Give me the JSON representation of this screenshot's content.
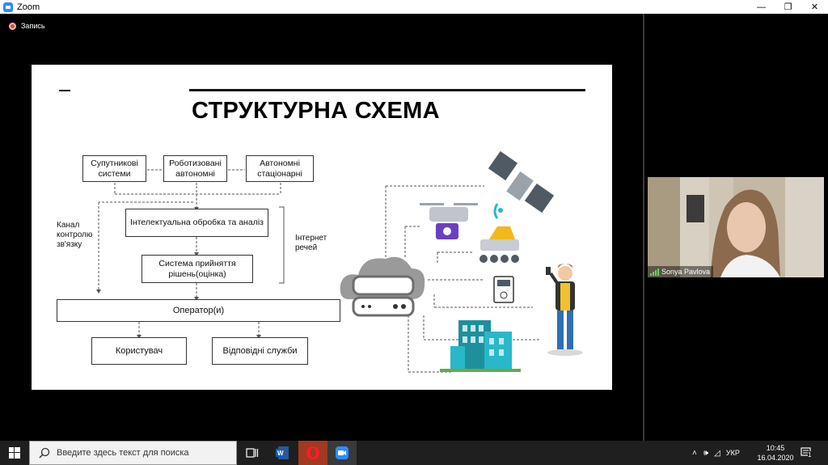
{
  "window": {
    "app_title": "Zoom",
    "controls": {
      "minimize": "—",
      "restore": "❐",
      "close": "✕"
    }
  },
  "recording": {
    "label": "Запись"
  },
  "slide": {
    "title": "СТРУКТУРНА СХЕМА",
    "boxes": {
      "satellite": "Супутникові системи",
      "robotic": "Роботизовані автономні",
      "autonomous": "Автономні стаціонарні",
      "processing": "Інтелектуальна обробка та аналіз",
      "decision": "Система прийняття рішень(оцінка)",
      "operator": "Оператор(и)",
      "user": "Користувач",
      "services": "Відповідні служби"
    },
    "labels": {
      "control_channel": "Канал контролю зв'язку",
      "iot": "Інтернет речей"
    }
  },
  "participant": {
    "name": "Sonya Pavlova"
  },
  "taskbar": {
    "search_placeholder": "Введите здесь текст для поиска",
    "language": "УКР",
    "time": "10:45",
    "date": "16.04.2020",
    "notification_count": "1"
  },
  "colors": {
    "zoom_blue": "#2d8cff",
    "record_red": "#e0463f",
    "taskbar": "#1f1f1f",
    "cloud_gray": "#9a9a9a",
    "building_teal": "#1f8f9c",
    "drone_purple": "#6b3fc4"
  }
}
